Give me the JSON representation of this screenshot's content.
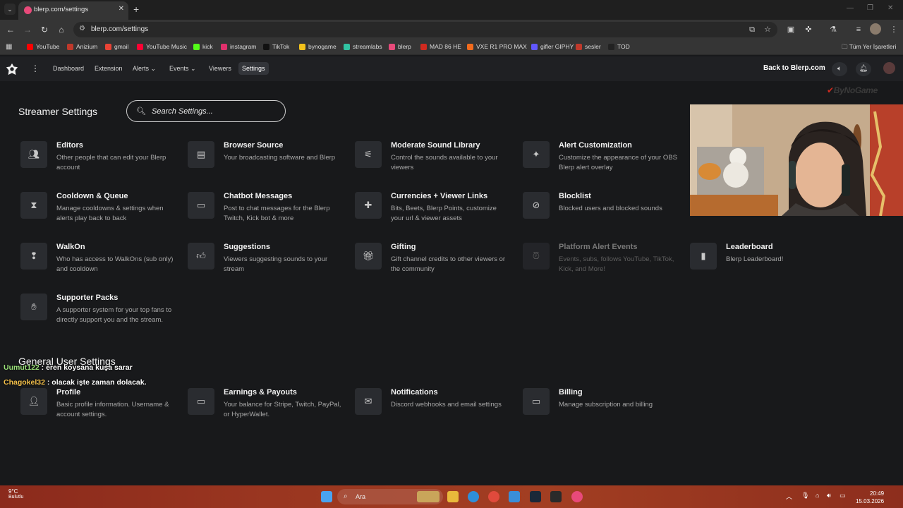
{
  "browser": {
    "tab_title": "blerp.com/settings",
    "url": "blerp.com/settings",
    "bookmarks": [
      {
        "label": "YouTube",
        "color": "#ff0000"
      },
      {
        "label": "Anizium",
        "color": "#c0392b"
      },
      {
        "label": "gmail",
        "color": "#ea4335"
      },
      {
        "label": "YouTube Music",
        "color": "#ff0033"
      },
      {
        "label": "kick",
        "color": "#53fc18"
      },
      {
        "label": "instagram",
        "color": "#e1306c"
      },
      {
        "label": "TikTok",
        "color": "#111111"
      },
      {
        "label": "bynogame",
        "color": "#f3c21b"
      },
      {
        "label": "streamlabs",
        "color": "#31c3a2"
      },
      {
        "label": "blerp",
        "color": "#e84a7a"
      },
      {
        "label": "MAD 86 HE",
        "color": "#d12a1f"
      },
      {
        "label": "VXE R1 PRO MAX",
        "color": "#f26b1d"
      },
      {
        "label": "gifler GIPHY",
        "color": "#6157ff"
      },
      {
        "label": "sesler",
        "color": "#c0392b"
      },
      {
        "label": "TOD",
        "color": "#222222"
      }
    ],
    "all_bookmarks": "Tüm Yer İşaretleri"
  },
  "nav": {
    "links": [
      "Dashboard",
      "Extension",
      "Alerts",
      "Events",
      "Viewers",
      "Settings"
    ],
    "back": "Back to Blerp.com"
  },
  "streamer": {
    "title": "Streamer Settings",
    "search_placeholder": "Search Settings...",
    "cards": [
      {
        "title": "Editors",
        "desc": "Other people that can edit your Blerp account",
        "icon": "people-icon"
      },
      {
        "title": "Browser Source",
        "desc": "Your broadcasting software and Blerp",
        "icon": "browser-icon"
      },
      {
        "title": "Moderate Sound Library",
        "desc": "Control the sounds available to your viewers",
        "icon": "sliders-icon"
      },
      {
        "title": "Alert Customization",
        "desc": "Customize the appearance of your OBS Blerp alert overlay",
        "icon": "magic-wand-icon"
      },
      {
        "title": "Cooldown & Queue",
        "desc": "Manage cooldowns & settings when alerts play back to back",
        "icon": "hourglass-icon"
      },
      {
        "title": "Chatbot Messages",
        "desc": "Post to chat messages for the Blerp Twitch, Kick bot & more",
        "icon": "chat-icon"
      },
      {
        "title": "Currencies + Viewer Links",
        "desc": "Bits, Beets, Blerp Points, customize your url & viewer assets",
        "icon": "puzzle-icon"
      },
      {
        "title": "Blocklist",
        "desc": "Blocked users and blocked sounds",
        "icon": "block-icon"
      },
      {
        "title": "WalkOn",
        "desc": "Who has access to WalkOns (sub only) and cooldown",
        "icon": "walk-icon"
      },
      {
        "title": "Suggestions",
        "desc": "Viewers suggesting sounds to your stream",
        "icon": "thumbs-up-icon"
      },
      {
        "title": "Gifting",
        "desc": "Gift channel credits to other viewers or the community",
        "icon": "gift-icon"
      },
      {
        "title": "Platform Alert Events",
        "desc": "Events, subs, follows YouTube, TikTok, Kick, and More!",
        "icon": "alarm-icon"
      },
      {
        "title": "Leaderboard",
        "desc": "Blerp Leaderboard!",
        "icon": "bar-chart-icon"
      },
      {
        "title": "Supporter Packs",
        "desc": "A supporter system for your top fans to directly support you and the stream.",
        "icon": "supporter-icon"
      }
    ]
  },
  "general": {
    "title": "General User Settings",
    "cards": [
      {
        "title": "Profile",
        "desc": "Basic profile information. Username & account settings.",
        "icon": "person-icon"
      },
      {
        "title": "Earnings & Payouts",
        "desc": "Your balance for Stripe, Twitch, PayPal, or HyperWallet.",
        "icon": "payout-icon"
      },
      {
        "title": "Notifications",
        "desc": "Discord webhooks and email settings",
        "icon": "mail-icon"
      },
      {
        "title": "Billing",
        "desc": "Manage subscription and billing",
        "icon": "credit-card-icon"
      }
    ]
  },
  "overlay": {
    "watermark": "ByNoGame",
    "chat": [
      {
        "user": "Uumut122",
        "user_color": "#9be37a",
        "message": " : eren koysana kuşa sarar"
      },
      {
        "user": "Chagokel32",
        "user_color": "#f4c04a",
        "message": " : olacak işte zaman dolacak."
      }
    ]
  },
  "taskbar": {
    "temp": "9°C",
    "weather": "Bulutlu",
    "search": "Ara",
    "time": "20:49",
    "date": "15.03.2026"
  }
}
